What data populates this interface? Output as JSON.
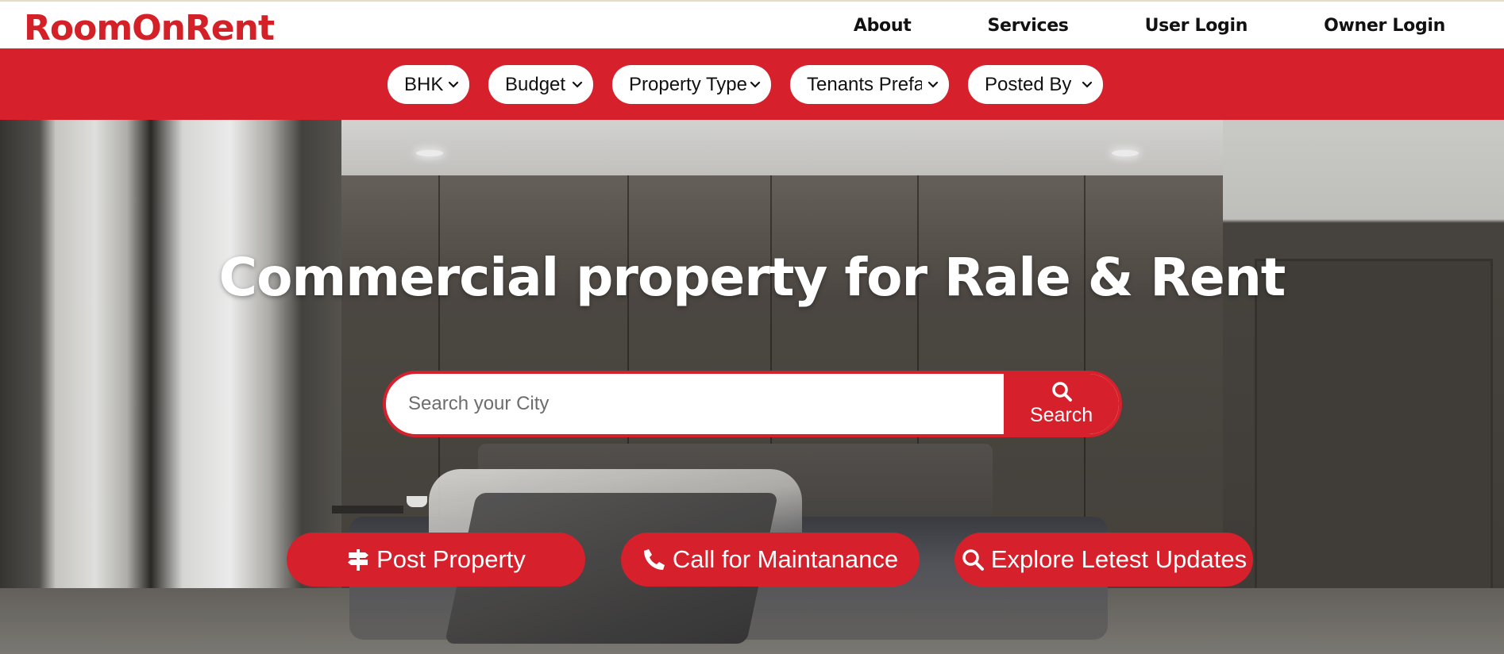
{
  "brand": {
    "logo_text": "RoomOnRent",
    "accent_color": "#d6202b"
  },
  "nav": {
    "items": [
      {
        "label": "About"
      },
      {
        "label": "Services"
      },
      {
        "label": "User Login"
      },
      {
        "label": "Owner Login"
      }
    ]
  },
  "filters": [
    {
      "label": "BHK"
    },
    {
      "label": "Budget"
    },
    {
      "label": "Property Type"
    },
    {
      "label": "Tenants Prefar"
    },
    {
      "label": "Posted By"
    }
  ],
  "hero": {
    "title": "Commercial property for Rale & Rent",
    "search": {
      "placeholder": "Search your City",
      "value": "",
      "button_label": "Search",
      "button_icon": "search-icon"
    }
  },
  "actions": [
    {
      "label": "Post Property",
      "icon": "signpost-icon"
    },
    {
      "label": "Call for Maintanance",
      "icon": "phone-icon"
    },
    {
      "label": "Explore Letest Updates",
      "icon": "search-icon"
    }
  ]
}
